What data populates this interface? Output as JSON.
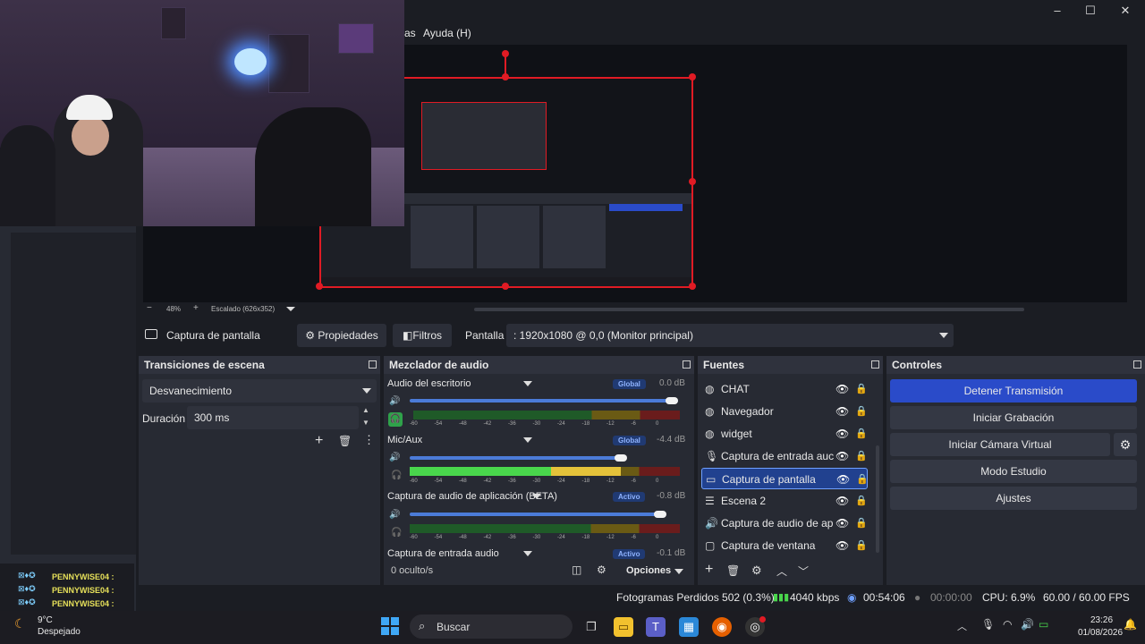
{
  "window": {
    "menu_visible": [
      "as",
      "Ayuda (H)"
    ],
    "minimize": "–",
    "maximize": "☐",
    "close": "✕"
  },
  "preview": {
    "zoom_minus": "−",
    "zoom_value": "48%",
    "zoom_plus": "+",
    "scale_label": "Escalado (626x352)"
  },
  "source_bar": {
    "icon": "monitor-icon",
    "source_name": "Captura de pantalla",
    "properties_label": "Propiedades",
    "filters_label": "Filtros",
    "display_label": "Pantalla",
    "display_value": ": 1920x1080 @ 0,0 (Monitor principal)"
  },
  "transitions": {
    "title": "Transiciones de escena",
    "selected": "Desvanecimiento",
    "duration_label": "Duración",
    "duration_value": "300 ms"
  },
  "mixer": {
    "title": "Mezclador de audio",
    "channels": [
      {
        "name": "Audio del escritorio",
        "badge": "Global",
        "db": "0.0 dB",
        "volume": 1.0,
        "level": 0.0
      },
      {
        "name": "Mic/Aux",
        "badge": "Global",
        "db": "-4.4 dB",
        "volume": 0.8,
        "level": 0.78
      },
      {
        "name": "Captura de audio de aplicación (BETA)",
        "badge": "Activo",
        "db": "-0.8 dB",
        "volume": 0.96,
        "level": 0.0
      },
      {
        "name": "Captura de entrada audio",
        "badge": "Activo",
        "db": "-0.1 dB",
        "volume": 1.0,
        "level": 0.0
      }
    ],
    "scale_ticks": [
      "-60",
      "-54",
      "-48",
      "-42",
      "-36",
      "-30",
      "-24",
      "-18",
      "-12",
      "-6",
      "0"
    ],
    "hidden_label": "0 oculto/s",
    "options_label": "Opciones"
  },
  "sources": {
    "title": "Fuentes",
    "items": [
      {
        "name": "CHAT",
        "icon": "globe-icon"
      },
      {
        "name": "Navegador",
        "icon": "globe-icon"
      },
      {
        "name": "widget",
        "icon": "globe-icon"
      },
      {
        "name": "Captura de entrada auc",
        "icon": "mic-icon"
      },
      {
        "name": "Captura de pantalla",
        "icon": "monitor-icon",
        "selected": true
      },
      {
        "name": "Escena 2",
        "icon": "list-icon"
      },
      {
        "name": "Captura de audio de ap",
        "icon": "speaker-icon"
      },
      {
        "name": "Captura de ventana",
        "icon": "window-icon"
      }
    ]
  },
  "controls": {
    "title": "Controles",
    "stop_stream": "Detener Transmisión",
    "start_recording": "Iniciar Grabación",
    "start_virtual_cam": "Iniciar Cámara Virtual",
    "studio_mode": "Modo Estudio",
    "settings": "Ajustes"
  },
  "status": {
    "dropped_frames": "Fotogramas Perdidos 502 (0.3%)",
    "bitrate": "4040 kbps",
    "stream_time": "00:54:06",
    "rec_time": "00:00:00",
    "cpu": "CPU: 6.9%",
    "fps": "60.00 / 60.00 FPS"
  },
  "chat": {
    "lines": [
      "PENNYWISE04 :",
      "PENNYWISE04 :",
      "PENNYWISE04 :"
    ]
  },
  "taskbar": {
    "weather_temp": "9°C",
    "weather_desc": "Despejado",
    "search_placeholder": "Buscar",
    "time": "23:26",
    "date": "01/08/2026"
  },
  "colors": {
    "accent": "#2a4bc9",
    "selection": "#21418f",
    "red_border": "#e01b24",
    "meter_green": "#49d64c"
  }
}
